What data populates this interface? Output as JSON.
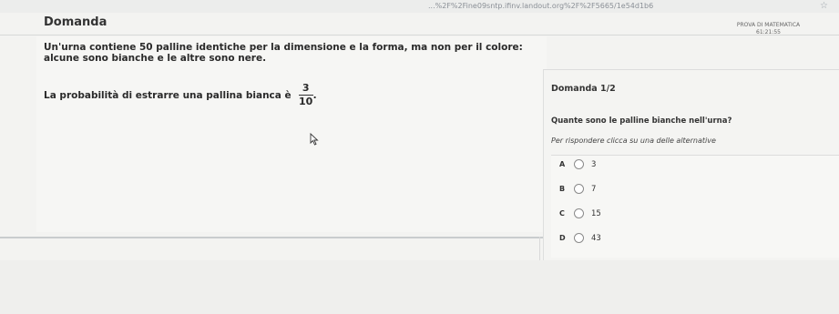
{
  "browser": {
    "url_text": "...%2F%2Fine09sntp.ifinv.landout.org%2F%2F5665/1e54d1b6"
  },
  "header": {
    "title": "Domanda",
    "exam_name": "PROVA DI MATEMATICA",
    "exam_time": "61:21:55"
  },
  "left": {
    "stem_line1": "Un'urna contiene 50 palline identiche per la dimensione e la forma, ma non per il colore:",
    "stem_line2": "alcune sono bianche e le altre sono nere.",
    "question_prefix": "La probabilità di estrarre una pallina bianca è",
    "fraction_num": "3",
    "fraction_den": "10",
    "question_suffix": "."
  },
  "right": {
    "counter": "Domanda 1/2",
    "question": "Quante sono le palline bianche nell'urna?",
    "instructions": "Per rispondere clicca su una delle alternative",
    "options": [
      {
        "letter": "A",
        "value": "3"
      },
      {
        "letter": "B",
        "value": "7"
      },
      {
        "letter": "C",
        "value": "15"
      },
      {
        "letter": "D",
        "value": "43"
      }
    ]
  }
}
